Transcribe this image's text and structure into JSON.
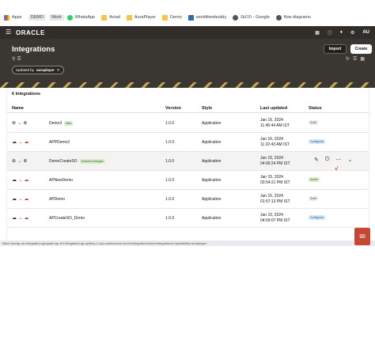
{
  "bookmarks": [
    {
      "label": "Apps",
      "icon": "apps-grid-icon"
    },
    {
      "label": "DEMO",
      "icon": ""
    },
    {
      "label": "Work",
      "icon": ""
    },
    {
      "label": "WhatsApp",
      "icon": "whatsapp-icon"
    },
    {
      "label": "Aviad",
      "icon": "folder-icon"
    },
    {
      "label": "AuraPlayer",
      "icon": "folder-icon"
    },
    {
      "label": "Demo",
      "icon": "folder-icon"
    },
    {
      "label": "worldtimebuddy",
      "icon": "doc-icon"
    },
    {
      "label": "תרגום - Google",
      "icon": "gear-icon"
    },
    {
      "label": "flow diagrams",
      "icon": "gear-icon"
    }
  ],
  "header": {
    "logo": "ORACLE",
    "avatar": "AU"
  },
  "page": {
    "title": "Integrations",
    "import_label": "Import",
    "create_label": "Create",
    "filter_prefix": "Updated by",
    "filter_value": "auraplayer"
  },
  "table": {
    "count": "6 Integrations",
    "columns": {
      "name": "Name",
      "version": "Version",
      "style": "Style",
      "updated": "Last updated",
      "status": "Status"
    },
    "rows": [
      {
        "name": "Demo3",
        "badge": "New",
        "version": "1.0.0",
        "style": "Application",
        "date": "Jan 16, 2024",
        "time": "11:45:44 AM IST",
        "status": "Draft",
        "status_kind": "draft"
      },
      {
        "name": "APPDemo2",
        "badge": "",
        "version": "1.0.0",
        "style": "Application",
        "date": "Jan 16, 2024",
        "time": "11:22:43 AM IST",
        "status": "Configured",
        "status_kind": "configured"
      },
      {
        "name": "DemoCreateSO",
        "badge": "Unsaved changes",
        "version": "1.0.0",
        "style": "Application",
        "date": "Jan 15, 2024",
        "time": "04:06:24 PM IST",
        "status": "",
        "status_kind": ""
      },
      {
        "name": "APNewDemo",
        "badge": "",
        "version": "1.0.0",
        "style": "Application",
        "date": "Jan 15, 2024",
        "time": "03:54:21 PM IST",
        "status": "Active",
        "status_kind": "active"
      },
      {
        "name": "APDemo",
        "badge": "",
        "version": "1.0.0",
        "style": "Application",
        "date": "Jan 15, 2024",
        "time": "01:57:13 PM IST",
        "status": "Draft",
        "status_kind": "draft"
      },
      {
        "name": "APCreateSO_Demo",
        "badge": "",
        "version": "1.0.0",
        "style": "Application",
        "date": "Jan 10, 2024",
        "time": "04:59:07 PM IST",
        "status": "Configured",
        "status_kind": "configured"
      }
    ]
  },
  "status_url": "https://aurap-oic-integration-ganpadri-ap-ie1.integration.ap-sydney-1.ocp.oraclecloud.com/ic/integration/home/integrations?updatedBy=auraplayer"
}
